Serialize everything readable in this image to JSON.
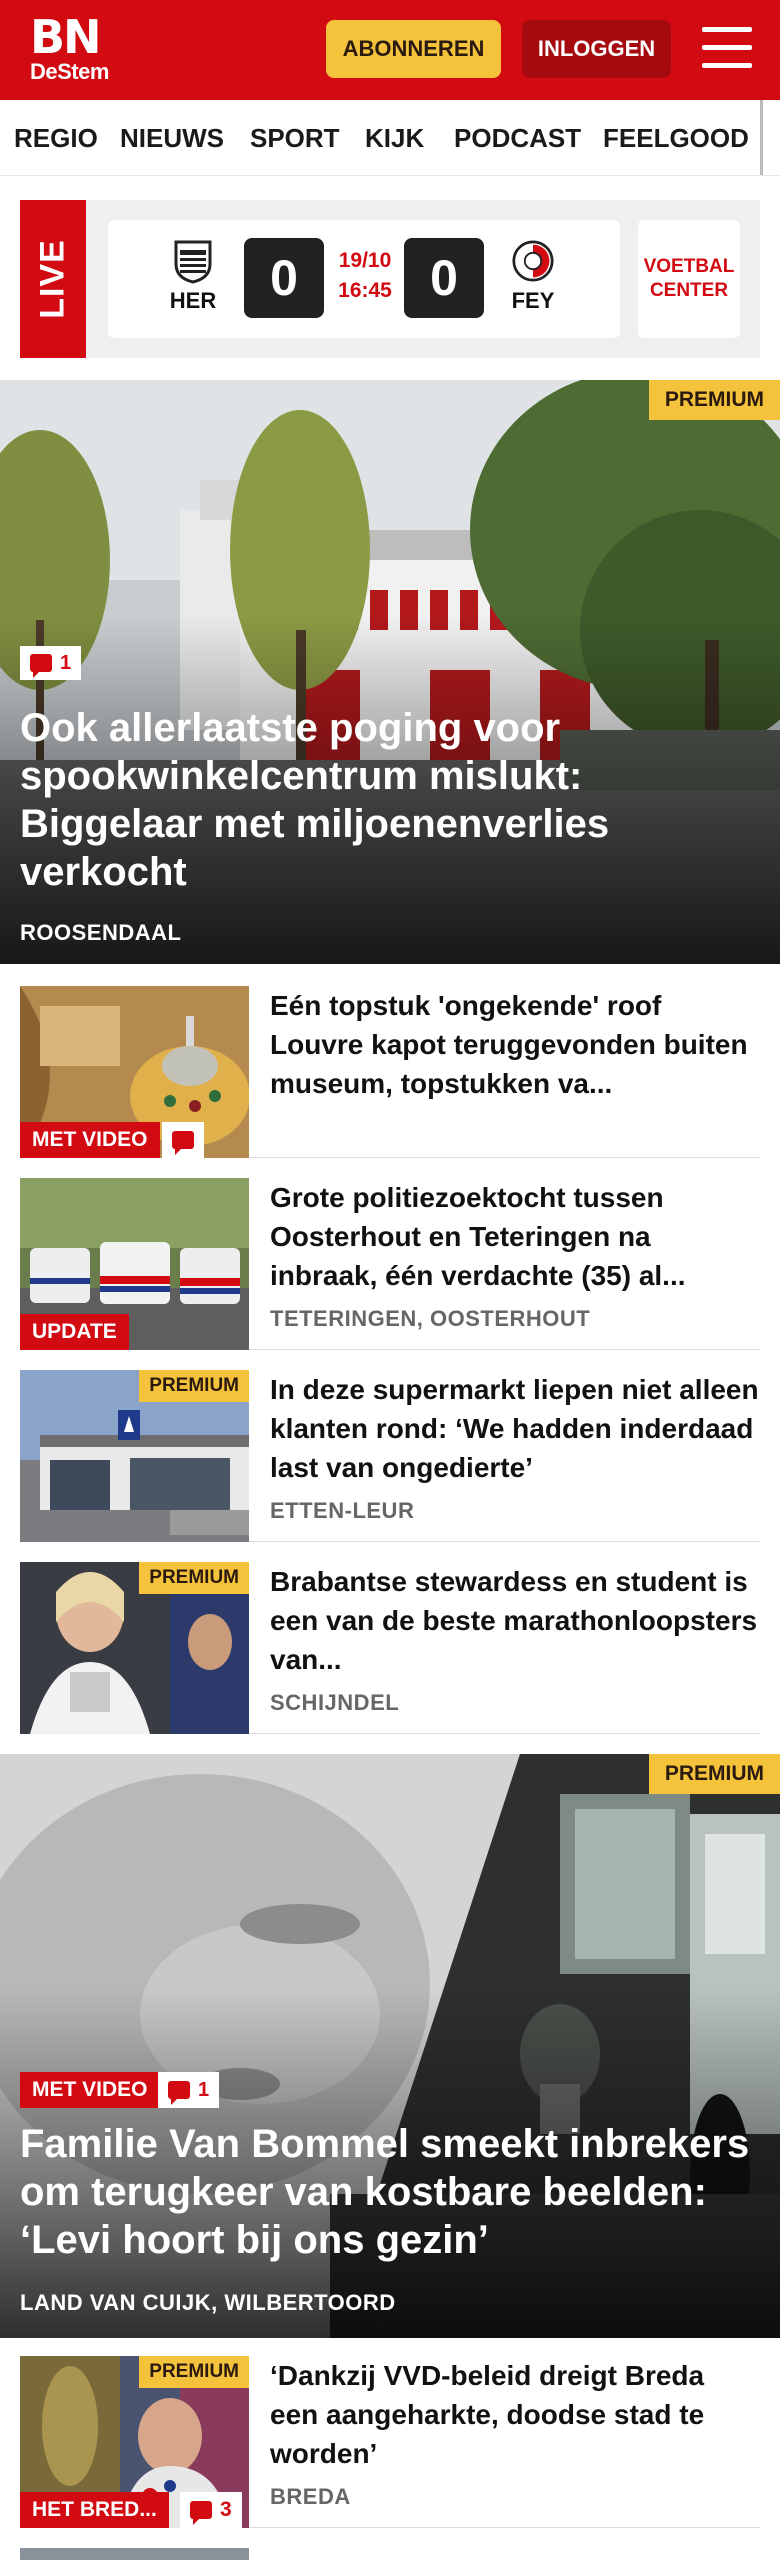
{
  "header": {
    "logo_main": "BN",
    "logo_sub": "DeStem",
    "subscribe_label": "ABONNEREN",
    "login_label": "INLOGGEN",
    "menu_icon": "hamburger-icon",
    "brand_color": "#d20a11"
  },
  "nav": {
    "items": [
      "REGIO",
      "NIEUWS",
      "SPORT",
      "KIJK",
      "PODCAST",
      "FEELGOOD"
    ]
  },
  "live": {
    "label": "LIVE",
    "home_team": "HER",
    "away_team": "FEY",
    "home_score": "0",
    "away_score": "0",
    "date": "19/10",
    "time": "16:45",
    "center_label": "VOETBAL CENTER"
  },
  "hero1": {
    "premium": "PREMIUM",
    "comments": "1",
    "title": "Ook allerlaatste poging voor spookwinkelcentrum mislukt: Biggelaar met miljoenenverlies verkocht",
    "location": "ROOSENDAAL"
  },
  "list1": [
    {
      "title": "Eén topstuk 'ongekende' roof Louvre kapot teruggevonden buiten museum, topstukken va...",
      "tag": "MET VIDEO",
      "location": ""
    },
    {
      "title": "Grote politiezoektocht tussen Oosterhout en Teteringen na inbraak, één verdachte (35) al...",
      "tag": "UPDATE",
      "location": "TETERINGEN, OOSTERHOUT"
    },
    {
      "title": "In deze supermarkt liepen niet alleen klanten rond: ‘We hadden inderdaad last van ongedierte’",
      "premium": "PREMIUM",
      "location": "ETTEN-LEUR"
    },
    {
      "title": "Brabantse stewardess en student is een van de beste marathonloopsters van...",
      "premium": "PREMIUM",
      "location": "SCHIJNDEL"
    }
  ],
  "hero2": {
    "premium": "PREMIUM",
    "tag": "MET VIDEO",
    "comments": "1",
    "title": "Familie Van Bommel smeekt inbrekers om terugkeer van kostbare beelden: ‘Levi hoort bij ons gezin’",
    "location": "LAND VAN CUIJK, WILBERTOORD"
  },
  "list2": [
    {
      "title": "‘Dankzij VVD-beleid dreigt Breda een aangeharkte, doodse stad te worden’",
      "premium": "PREMIUM",
      "tag": "HET BRED...",
      "comments": "3",
      "location": "BREDA"
    }
  ]
}
